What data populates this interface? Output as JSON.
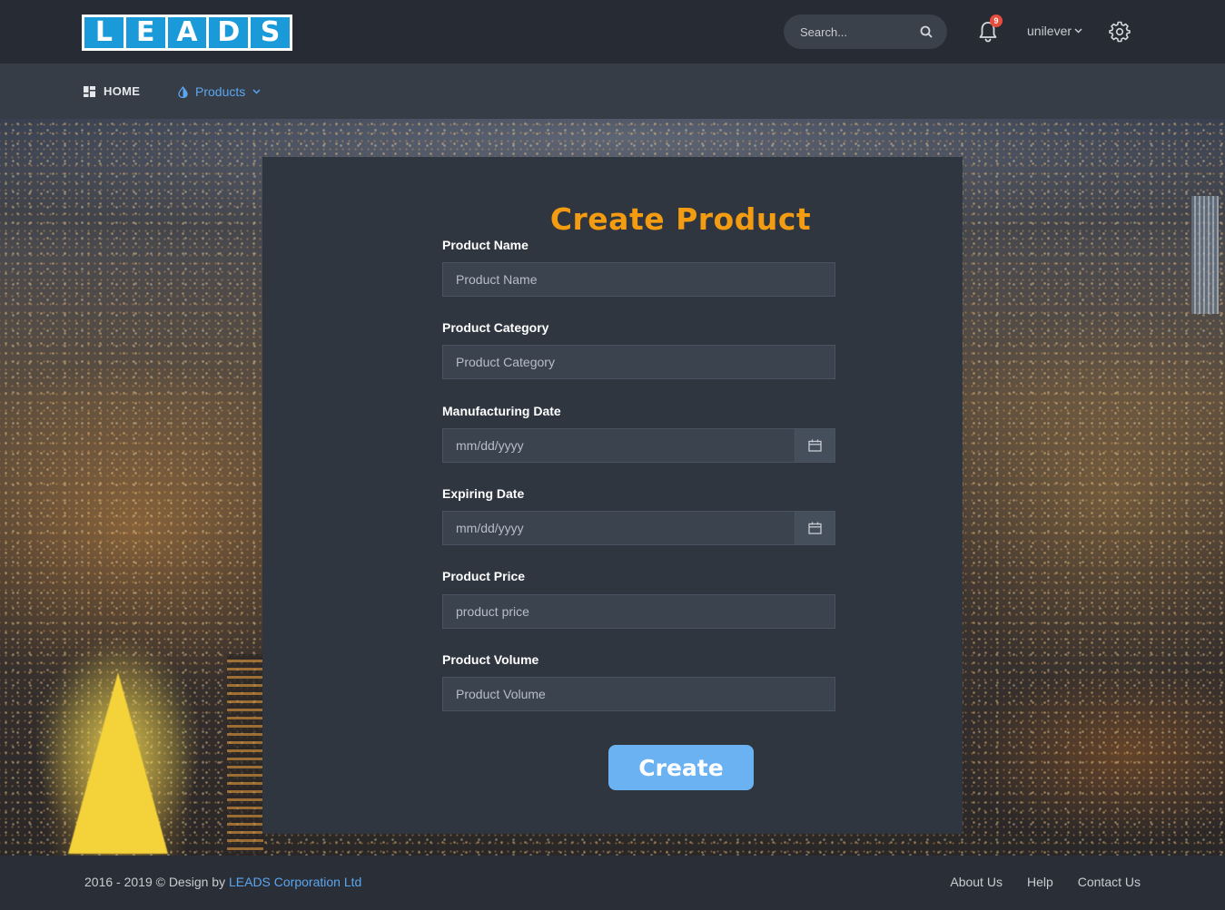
{
  "header": {
    "logo_letters": [
      "L",
      "E",
      "A",
      "D",
      "S"
    ],
    "search_placeholder": "Search...",
    "notification_count": "9",
    "username": "unilever"
  },
  "nav": {
    "home_label": "HOME",
    "products_label": "Products"
  },
  "form": {
    "title": "Create Product",
    "fields": [
      {
        "label": "Product Name",
        "placeholder": "Product Name"
      },
      {
        "label": "Product Category",
        "placeholder": "Product Category"
      },
      {
        "label": "Manufacturing Date",
        "placeholder": "mm/dd/yyyy"
      },
      {
        "label": "Expiring Date",
        "placeholder": "mm/dd/yyyy"
      },
      {
        "label": "Product Price",
        "placeholder": "product price"
      },
      {
        "label": "Product Volume",
        "placeholder": "Product Volume"
      }
    ],
    "submit_label": "Create"
  },
  "footer": {
    "copyright_prefix": "2016 - 2019 © Design by ",
    "company_link": "LEADS Corporation Ltd",
    "links": [
      "About Us",
      "Help",
      "Contact Us"
    ]
  },
  "colors": {
    "accent": "#f39c12",
    "link": "#5ba6f0",
    "button": "#6ab2f2",
    "logo": "#1b9ad9"
  }
}
